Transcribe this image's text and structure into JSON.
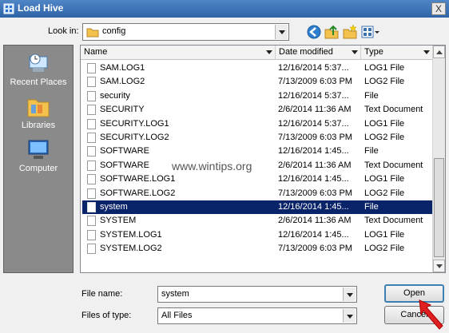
{
  "window": {
    "title": "Load Hive",
    "close_label": "X"
  },
  "lookin": {
    "label": "Look in:",
    "value": "config"
  },
  "toolbar": {
    "icons": [
      "back-icon",
      "up-folder-icon",
      "new-folder-icon",
      "view-menu-icon"
    ]
  },
  "places": [
    {
      "label": "Recent Places",
      "icon": "recent-places-icon"
    },
    {
      "label": "Libraries",
      "icon": "libraries-icon"
    },
    {
      "label": "Computer",
      "icon": "computer-icon"
    }
  ],
  "list": {
    "columns": [
      "Name",
      "Date modified",
      "Type"
    ],
    "rows": [
      {
        "name": "SAM.LOG1",
        "date": "12/16/2014 5:37...",
        "type": "LOG1 File"
      },
      {
        "name": "SAM.LOG2",
        "date": "7/13/2009 6:03 PM",
        "type": "LOG2 File"
      },
      {
        "name": "security",
        "date": "12/16/2014 5:37...",
        "type": "File"
      },
      {
        "name": "SECURITY",
        "date": "2/6/2014 11:36 AM",
        "type": "Text Document"
      },
      {
        "name": "SECURITY.LOG1",
        "date": "12/16/2014 5:37...",
        "type": "LOG1 File"
      },
      {
        "name": "SECURITY.LOG2",
        "date": "7/13/2009 6:03 PM",
        "type": "LOG2 File"
      },
      {
        "name": "SOFTWARE",
        "date": "12/16/2014 1:45...",
        "type": "File"
      },
      {
        "name": "SOFTWARE",
        "date": "2/6/2014 11:36 AM",
        "type": "Text Document"
      },
      {
        "name": "SOFTWARE.LOG1",
        "date": "12/16/2014 1:45...",
        "type": "LOG1 File"
      },
      {
        "name": "SOFTWARE.LOG2",
        "date": "7/13/2009 6:03 PM",
        "type": "LOG2 File"
      },
      {
        "name": "system",
        "date": "12/16/2014 1:45...",
        "type": "File",
        "selected": true
      },
      {
        "name": "SYSTEM",
        "date": "2/6/2014 11:36 AM",
        "type": "Text Document"
      },
      {
        "name": "SYSTEM.LOG1",
        "date": "12/16/2014 1:45...",
        "type": "LOG1 File"
      },
      {
        "name": "SYSTEM.LOG2",
        "date": "7/13/2009 6:03 PM",
        "type": "LOG2 File"
      }
    ]
  },
  "watermark": "www.wintips.org",
  "filename": {
    "label": "File name:",
    "value": "system"
  },
  "filetype": {
    "label": "Files of type:",
    "value": "All Files"
  },
  "buttons": {
    "open": "Open",
    "cancel": "Cancel"
  },
  "colors": {
    "selection": "#0a246a",
    "places_bg": "#8a8a8a",
    "pointer_arrow": "#e02020"
  }
}
